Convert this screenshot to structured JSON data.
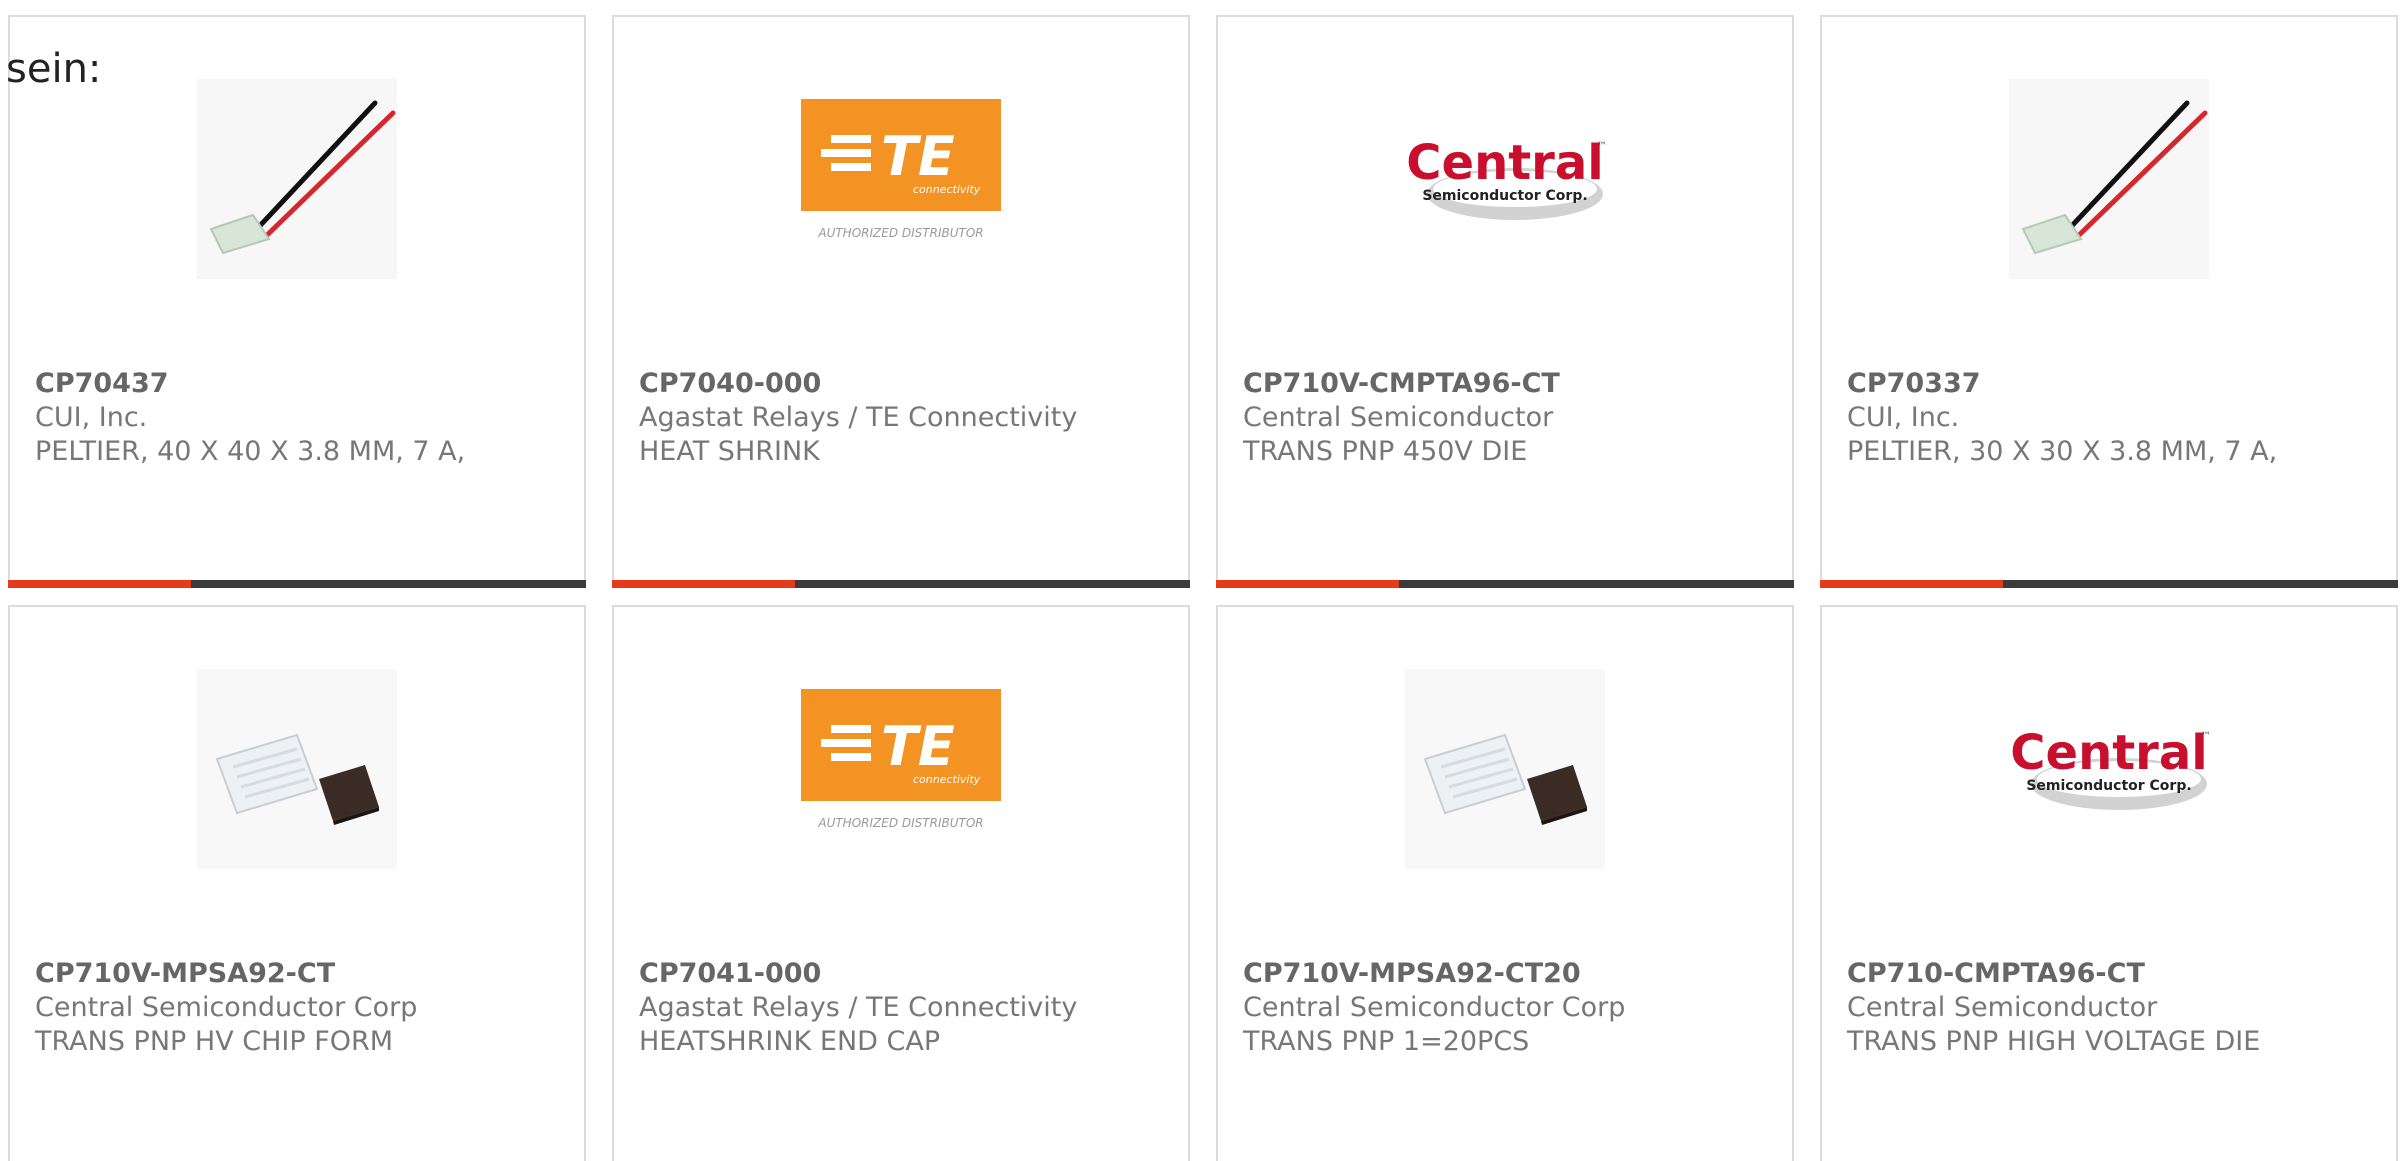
{
  "prefix": "sein:",
  "colors": {
    "accent": "#e63b1b",
    "bar": "#3b3b3b",
    "te_orange": "#f39323",
    "central_red": "#c8102e"
  },
  "cards": [
    {
      "part": "CP70437",
      "manufacturer": "CUI, Inc.",
      "description": "PELTIER, 40 X 40 X 3.8 MM, 7 A,",
      "image": "peltier-wire-icon"
    },
    {
      "part": "CP7040-000",
      "manufacturer": "Agastat Relays / TE Connectivity",
      "description": "HEAT SHRINK",
      "image": "te-logo",
      "logo": {
        "mark": "TE",
        "sub": "connectivity",
        "caption": "AUTHORIZED DISTRIBUTOR"
      }
    },
    {
      "part": "CP710V-CMPTA96-CT",
      "manufacturer": "Central Semiconductor",
      "description": "TRANS PNP 450V DIE",
      "image": "central-logo",
      "logo": {
        "mark": "Central",
        "sub": "Semiconductor Corp.",
        "tm": "™"
      }
    },
    {
      "part": "CP70337",
      "manufacturer": "CUI, Inc.",
      "description": "PELTIER, 30 X 30 X 3.8 MM, 7 A,",
      "image": "peltier-wire-icon"
    },
    {
      "part": "CP710V-MPSA92-CT",
      "manufacturer": "Central Semiconductor Corp",
      "description": "TRANS PNP HV CHIP FORM",
      "image": "chip-icon"
    },
    {
      "part": "CP7041-000",
      "manufacturer": "Agastat Relays / TE Connectivity",
      "description": "HEATSHRINK END CAP",
      "image": "te-logo",
      "logo": {
        "mark": "TE",
        "sub": "connectivity",
        "caption": "AUTHORIZED DISTRIBUTOR"
      }
    },
    {
      "part": "CP710V-MPSA92-CT20",
      "manufacturer": "Central Semiconductor Corp",
      "description": "TRANS PNP 1=20PCS",
      "image": "chip-icon"
    },
    {
      "part": "CP710-CMPTA96-CT",
      "manufacturer": "Central Semiconductor",
      "description": "TRANS PNP HIGH VOLTAGE DIE",
      "image": "central-logo",
      "logo": {
        "mark": "Central",
        "sub": "Semiconductor Corp.",
        "tm": "™"
      }
    }
  ]
}
